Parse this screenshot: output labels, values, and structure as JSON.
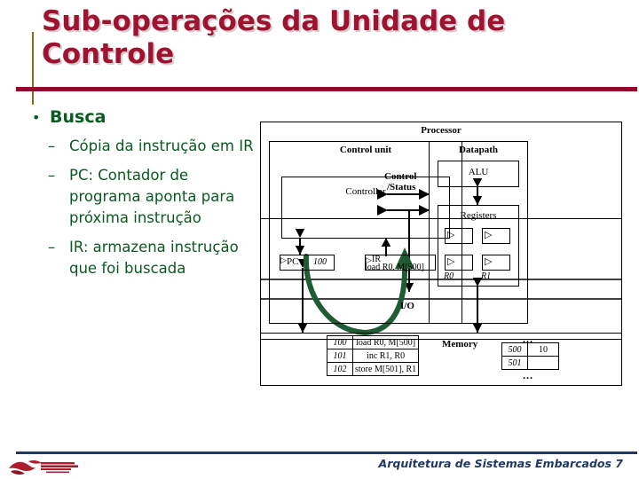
{
  "slide": {
    "title": "Sub-operações da Unidade de Controle",
    "accent_color": "#9e1330",
    "rule_color": "#8c0b28",
    "bullet_color": "#0a5a22",
    "footer_color": "#1f3864"
  },
  "bullets": {
    "level1": "Busca",
    "dot": "•",
    "dash": "–",
    "items": [
      "Cópia da instrução em IR",
      "PC: Contador de programa aponta para próxima instrução",
      "IR: armazena instrução que foi buscada"
    ]
  },
  "diagram": {
    "processor_label": "Processor",
    "control_unit_label": "Control unit",
    "controller_label": "Controller",
    "control_status_line1": "Control",
    "control_status_line2": "/Status",
    "datapath_label": "Datapath",
    "alu_label": "ALU",
    "registers_label": "Registers",
    "register_names": [
      "R0",
      "R1"
    ],
    "register_glyph": "▷",
    "pc_label": "PC",
    "pc_value": "100",
    "ir_label": "IR",
    "ir_value": "load R0, M[500]",
    "io_label": "I/O",
    "memory_label": "Memory",
    "program_rows": [
      {
        "address": "100",
        "instruction": "load R0, M[500]"
      },
      {
        "address": "101",
        "instruction": "inc R1, R0"
      },
      {
        "address": "102",
        "instruction": "store M[501], R1"
      }
    ],
    "data_rows": [
      {
        "address": "500",
        "value": "10"
      },
      {
        "address": "501",
        "value": ""
      }
    ],
    "ellipsis": "...",
    "fetch_arrow_color": "#1f5c33"
  },
  "footer": {
    "text": "Arquitetura de Sistemas Embarcados 7"
  }
}
